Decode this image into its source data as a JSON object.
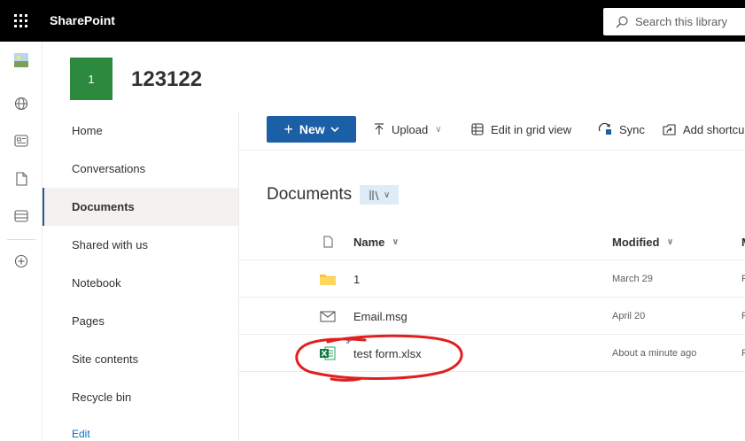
{
  "suite": {
    "app_name": "SharePoint",
    "search_placeholder": "Search this library"
  },
  "rail": {
    "items": [
      "avatar",
      "globe-icon",
      "news-icon",
      "document-icon",
      "list-icon",
      "add-circle-icon"
    ]
  },
  "site": {
    "logo_text": "1",
    "title": "123122"
  },
  "nav": {
    "items": [
      {
        "label": "Home"
      },
      {
        "label": "Conversations"
      },
      {
        "label": "Documents",
        "selected": true
      },
      {
        "label": "Shared with us"
      },
      {
        "label": "Notebook"
      },
      {
        "label": "Pages"
      },
      {
        "label": "Site contents"
      },
      {
        "label": "Recycle bin"
      }
    ],
    "edit_label": "Edit"
  },
  "commands": {
    "new_label": "New",
    "upload_label": "Upload",
    "grid_label": "Edit in grid view",
    "sync_label": "Sync",
    "shortcut_label": "Add shortcu"
  },
  "library": {
    "title": "Documents"
  },
  "columns": {
    "name": "Name",
    "modified": "Modified",
    "cutoff": "M"
  },
  "files": [
    {
      "type": "folder",
      "name": "1",
      "modified": "March 29",
      "cutoff": "F"
    },
    {
      "type": "email",
      "name": "Email.msg",
      "modified": "April 20",
      "cutoff": "F"
    },
    {
      "type": "excel",
      "name": "test form.xlsx",
      "modified": "About a minute ago",
      "cutoff": "F"
    }
  ],
  "colors": {
    "suite_bar": "#000000",
    "accent": "#1b5fa6",
    "site_logo": "#2b8a3e",
    "annotation": "#e02020"
  }
}
